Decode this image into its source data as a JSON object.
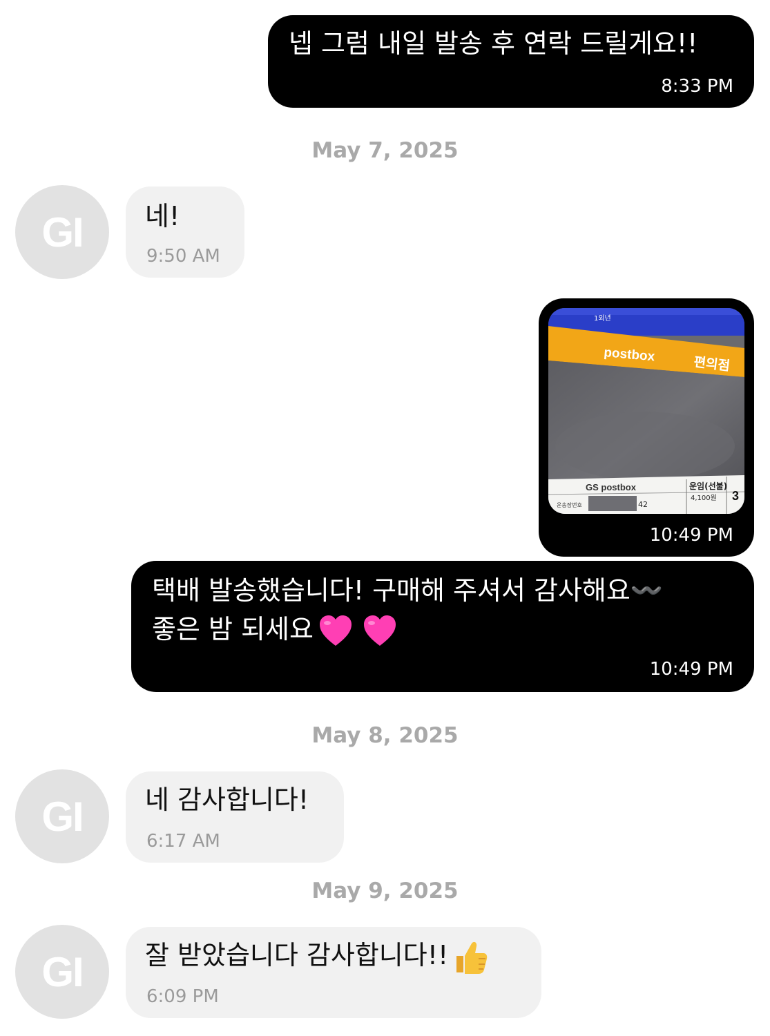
{
  "messages": {
    "m1": {
      "text": "넵 그럼 내일 발송 후 연락 드릴게요!!",
      "time": "8:33 PM"
    },
    "date1": "May 7, 2025",
    "m2": {
      "avatar": "GI",
      "text": "네!",
      "time": "9:50 AM"
    },
    "m3": {
      "time": "10:49 PM",
      "photo": {
        "sign_top": "1외년",
        "sign_brand": "postbox",
        "sign_store": "편의점",
        "label_brand": "GS postbox",
        "label_fee_title": "운임(선불)",
        "label_fee_value": "4,100원",
        "label_tracking_caption": "운송장번호",
        "label_tracking_suffix": "42",
        "label_edge_digit": "3"
      }
    },
    "m4": {
      "line1": "택배 발송했습니다! 구매해 주셔서 감사해요〰️",
      "line2": "좋은 밤 되세요",
      "emoji": [
        "pink-heart",
        "pink-heart"
      ],
      "time": "10:49 PM"
    },
    "date2": "May 8, 2025",
    "m5": {
      "avatar": "GI",
      "text": "네 감사합니다!",
      "time": "6:17 AM"
    },
    "date3": "May 9, 2025",
    "m6": {
      "avatar": "GI",
      "text": "잘 받았습니다 감사합니다!!",
      "emoji": "thumbs-up",
      "time": "6:09 PM"
    }
  },
  "colors": {
    "outgoing_bubble": "#000000",
    "incoming_bubble": "#f1f1f1",
    "avatar_bg": "#e2e2e2",
    "heart": "#ff3fb4",
    "thumb": "#f7c23a"
  }
}
